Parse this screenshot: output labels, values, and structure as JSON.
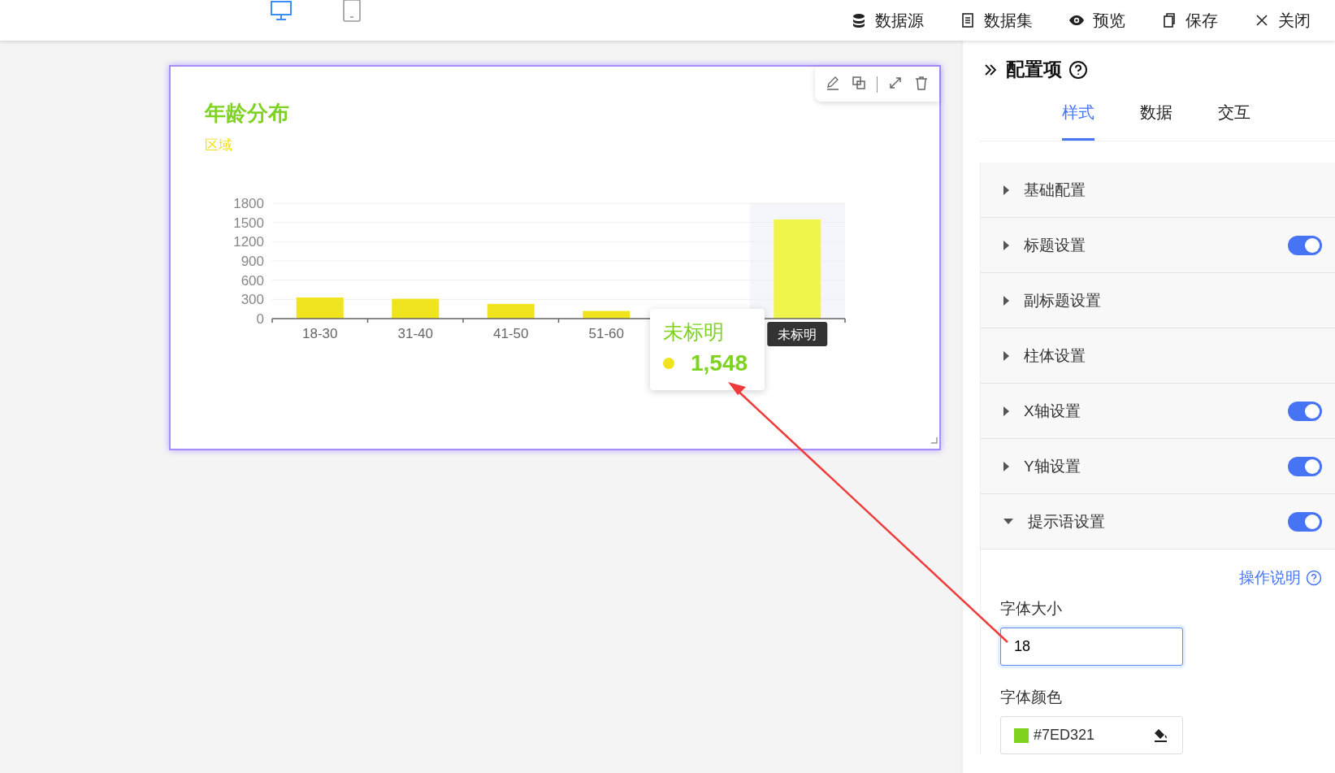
{
  "toolbar": {
    "devices": [
      {
        "selected": true
      },
      {
        "selected": false
      }
    ],
    "actions": [
      {
        "label": "数据源"
      },
      {
        "label": "数据集"
      },
      {
        "label": "预览"
      },
      {
        "label": "保存"
      },
      {
        "label": "关闭"
      }
    ]
  },
  "card": {
    "title": "年龄分布",
    "subtitle": "区域",
    "chart_data": {
      "type": "bar",
      "categories": [
        "18-30",
        "31-40",
        "41-50",
        "51-60",
        null,
        "未标明"
      ],
      "values": [
        330,
        310,
        230,
        120,
        null,
        1548
      ],
      "ylim": [
        0,
        1800
      ],
      "yticks": [
        0,
        300,
        600,
        900,
        1200,
        1500,
        1800
      ],
      "grid": true
    },
    "tooltip": {
      "title": "未标明",
      "value": "1,548"
    }
  },
  "panel": {
    "title": "配置项",
    "tabs": [
      {
        "label": "样式",
        "selected": true
      },
      {
        "label": "数据",
        "selected": false
      },
      {
        "label": "交互",
        "selected": false
      }
    ],
    "sections": [
      {
        "label": "基础配置",
        "expanded": false
      },
      {
        "label": "标题设置",
        "expanded": false,
        "on": true
      },
      {
        "label": "副标题设置",
        "expanded": false
      },
      {
        "label": "柱体设置",
        "expanded": false
      },
      {
        "label": "X轴设置",
        "expanded": false,
        "on": true
      },
      {
        "label": "Y轴设置",
        "expanded": false,
        "on": true
      },
      {
        "label": "提示语设置",
        "expanded": true,
        "on": true
      }
    ],
    "help_link": "操作说明",
    "fields": [
      {
        "kind": "text",
        "label": "字体大小",
        "value": "18"
      },
      {
        "kind": "color",
        "label": "字体颜色",
        "value": "#7ED321",
        "color": "#7ed321"
      }
    ]
  }
}
